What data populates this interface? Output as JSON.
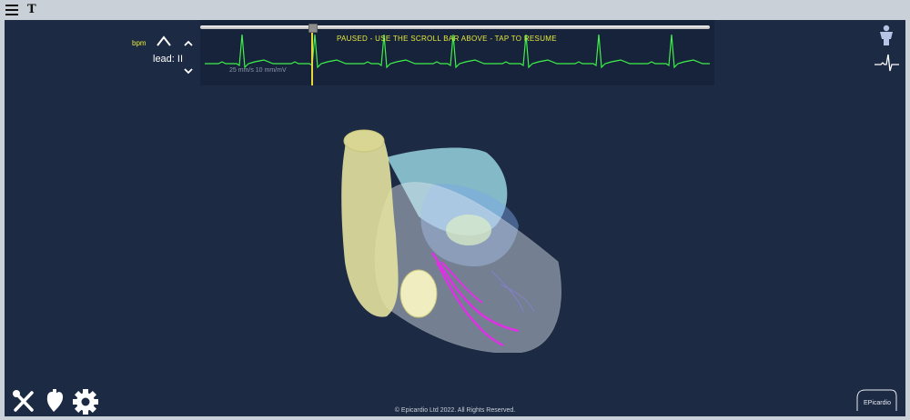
{
  "topbar": {
    "menu_icon": "hamburger-menu-icon",
    "text_tool_label": "T"
  },
  "ecg": {
    "bpm_label": "bpm",
    "lead_label": "lead: II",
    "paused_message": "PAUSED - USE THE SCROLL BAR ABOVE - TAP TO RESUME",
    "scale_label": "25 mm/s   10 mm/mV",
    "scroll_position": 0.22,
    "trace_color": "#3ef04a",
    "cursor_color": "#e8d53a"
  },
  "right_tools": {
    "body_icon": "human-body-icon",
    "ecg_icon": "ecg-waveform-icon"
  },
  "bottom_tools": {
    "tools_icon": "tools-icon",
    "heart_icon": "heart-hand-icon",
    "settings_icon": "gear-icon"
  },
  "footer": {
    "copyright": "© Epicardio Ltd 2022. All Rights Reserved."
  },
  "logo": {
    "text": "EPicardio"
  },
  "colors": {
    "background": "#1c2a44",
    "accent_yellow": "#e6ea3c",
    "conduction_path": "#e030e6"
  }
}
